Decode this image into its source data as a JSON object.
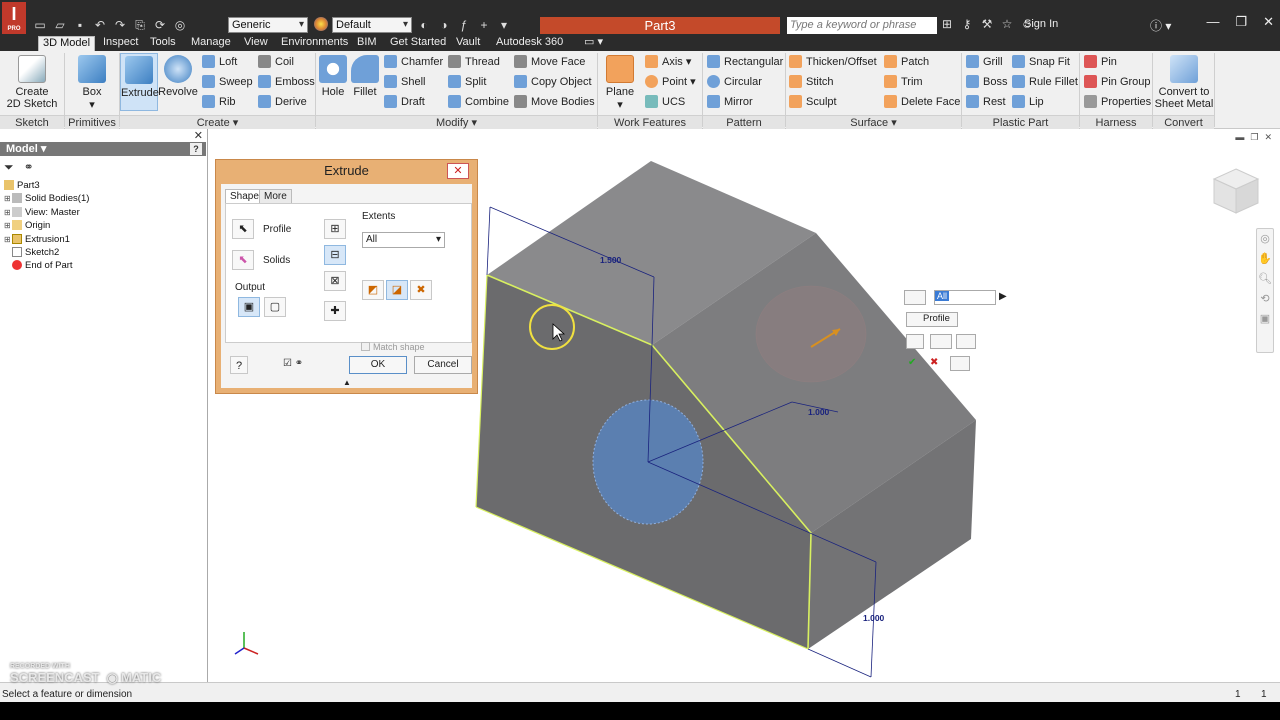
{
  "app": {
    "logo_text": "I",
    "logo_sub": "PRO",
    "document_title": "Part3",
    "material": "Generic",
    "appearance": "Default",
    "search_placeholder": "Type a keyword or phrase",
    "sign_in": "Sign In"
  },
  "tabs": [
    "3D Model",
    "Inspect",
    "Tools",
    "Manage",
    "View",
    "Environments",
    "BIM",
    "Get Started",
    "Vault",
    "Autodesk 360"
  ],
  "ribbon": {
    "sketch": {
      "create_label_1": "Create",
      "create_label_2": "2D Sketch",
      "panel": "Sketch"
    },
    "primitives": {
      "box": "Box",
      "panel": "Primitives"
    },
    "create": {
      "extrude": "Extrude",
      "revolve": "Revolve",
      "loft": "Loft",
      "coil": "Coil",
      "sweep": "Sweep",
      "emboss": "Emboss",
      "rib": "Rib",
      "derive": "Derive",
      "panel": "Create"
    },
    "modify": {
      "hole": "Hole",
      "fillet": "Fillet",
      "chamfer": "Chamfer",
      "thread": "Thread",
      "move_face": "Move Face",
      "shell": "Shell",
      "split": "Split",
      "copy_object": "Copy Object",
      "draft": "Draft",
      "combine": "Combine",
      "move_bodies": "Move Bodies",
      "panel": "Modify"
    },
    "work": {
      "plane": "Plane",
      "axis": "Axis",
      "point": "Point",
      "ucs": "UCS",
      "panel": "Work Features"
    },
    "pattern": {
      "rectangular": "Rectangular",
      "circular": "Circular",
      "mirror": "Mirror",
      "panel": "Pattern"
    },
    "surface": {
      "thicken": "Thicken/Offset",
      "stitch": "Stitch",
      "sculpt": "Sculpt",
      "patch": "Patch",
      "trim": "Trim",
      "delete_face": "Delete Face",
      "panel": "Surface"
    },
    "plastic": {
      "grill": "Grill",
      "boss": "Boss",
      "rest": "Rest",
      "snap_fit": "Snap Fit",
      "rule_fillet": "Rule Fillet",
      "lip": "Lip",
      "panel": "Plastic Part"
    },
    "harness": {
      "pin": "Pin",
      "pin_group": "Pin Group",
      "properties": "Properties",
      "panel": "Harness"
    },
    "convert": {
      "label_1": "Convert to",
      "label_2": "Sheet Metal",
      "panel": "Convert"
    }
  },
  "browser": {
    "header": "Model",
    "tree": [
      "Part3",
      "Solid Bodies(1)",
      "View: Master",
      "Origin",
      "Extrusion1",
      "Sketch2",
      "End of Part"
    ]
  },
  "dialog": {
    "title": "Extrude",
    "tab_shape": "Shape",
    "tab_more": "More",
    "profile": "Profile",
    "solids": "Solids",
    "output": "Output",
    "extents": "Extents",
    "extents_value": "All",
    "match_shape": "Match shape",
    "ok": "OK",
    "cancel": "Cancel"
  },
  "minitoolbar": {
    "value": "All",
    "profile": "Profile"
  },
  "dimensions": [
    "1.500",
    "1.000",
    "1.000"
  ],
  "status": {
    "message": "Select a feature or dimension",
    "count_1": "1",
    "count_2": "1"
  },
  "watermark": {
    "line1": "RECORDED WITH",
    "line2": "SCREENCAST",
    "line3": "MATIC"
  },
  "colors": {
    "accent": "#c44a2a",
    "selection": "#d8f060",
    "model_gray": "#7b7b7d",
    "profile_blue": "#5b7fb0"
  }
}
